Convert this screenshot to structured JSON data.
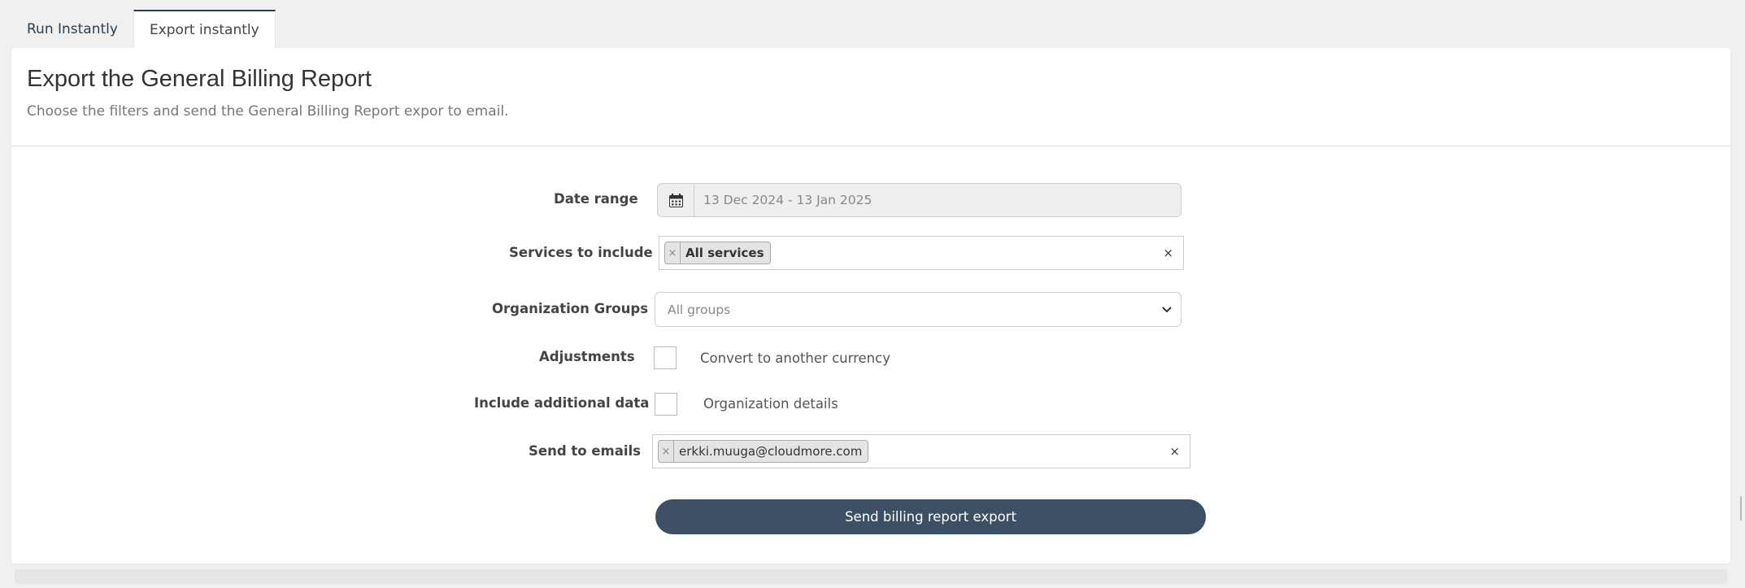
{
  "tabs": [
    {
      "label": "Run Instantly",
      "active": false
    },
    {
      "label": "Export instantly",
      "active": true
    }
  ],
  "header": {
    "title": "Export the General Billing Report",
    "subtitle": "Choose the filters and send the General Billing Report expor to email."
  },
  "form": {
    "date_range": {
      "label": "Date range",
      "value": "13 Dec 2024 - 13 Jan 2025",
      "icon": "calendar-icon"
    },
    "services": {
      "label": "Services to include",
      "tags": [
        "All services"
      ],
      "clear": "×",
      "tag_remove": "×"
    },
    "org_groups": {
      "label": "Organization Groups",
      "selected": "All groups"
    },
    "adjustments": {
      "label": "Adjustments",
      "option_label": "Convert to another currency",
      "checked": false
    },
    "additional_data": {
      "label": "Include additional data",
      "option_label": "Organization details",
      "checked": false
    },
    "emails": {
      "label": "Send to emails",
      "tags": [
        "erkki.muuga@cloudmore.com"
      ],
      "clear": "×",
      "tag_remove": "×"
    },
    "submit_label": "Send billing report export"
  },
  "colors": {
    "primary_button": "#3b5064",
    "tab_accent": "#2d3e50",
    "page_bg": "#f0f0f0"
  }
}
